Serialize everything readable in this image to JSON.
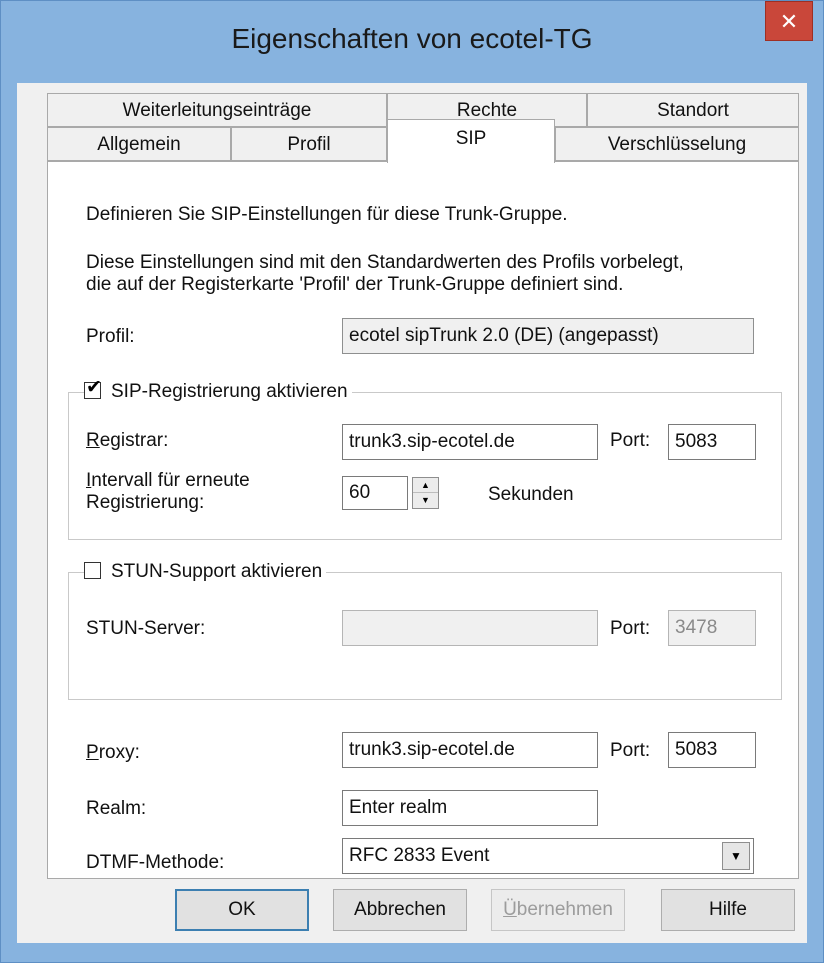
{
  "window": {
    "title": "Eigenschaften von ecotel-TG",
    "close_glyph": "✕"
  },
  "tabs": {
    "row1": [
      "Weiterleitungseinträge",
      "Rechte",
      "Standort"
    ],
    "row2": [
      "Allgemein",
      "Profil",
      "SIP",
      "Verschlüsselung"
    ],
    "active": "SIP"
  },
  "sip": {
    "intro": "Definieren Sie SIP-Einstellungen für diese Trunk-Gruppe.",
    "info_line1": "Diese Einstellungen sind mit den Standardwerten des Profils vorbelegt,",
    "info_line2": "die auf der Registerkarte  'Profil' der Trunk-Gruppe definiert sind.",
    "profil_label": "Profil:",
    "profil_value": "ecotel sipTrunk 2.0 (DE) (angepasst)",
    "registration": {
      "checkbox_label": "SIP-Registrierung aktivieren",
      "checked": true,
      "check_glyph": "✔",
      "registrar_accel": "R",
      "registrar_rest": "egistrar:",
      "registrar_value": "trunk3.sip-ecotel.de",
      "port_label": "Port:",
      "port_value": "5083",
      "interval_accel": "I",
      "interval_rest1": "ntervall für erneute",
      "interval_line2": "Registrierung:",
      "interval_value": "60",
      "interval_unit": "Sekunden",
      "spin_up": "▲",
      "spin_down": "▼"
    },
    "stun": {
      "checkbox_label": "STUN-Support aktivieren",
      "checked": false,
      "server_label": "STUN-Server:",
      "server_value": "",
      "port_label": "Port:",
      "port_value": "3478"
    },
    "proxy_accel": "P",
    "proxy_rest": "roxy:",
    "proxy_value": "trunk3.sip-ecotel.de",
    "proxy_port_label": "Port:",
    "proxy_port_value": "5083",
    "realm_label": "Realm:",
    "realm_value": "Enter realm",
    "dtmf_label": "DTMF-Methode:",
    "dtmf_value": "RFC 2833 Event",
    "dtmf_arrow": "▼"
  },
  "buttons": {
    "ok": "OK",
    "cancel": "Abbrechen",
    "apply_accel": "Ü",
    "apply_rest": "bernehmen",
    "help": "Hilfe"
  },
  "colors": {
    "title_bar": "#87b3df",
    "close": "#c9473a",
    "dialog_bg": "#f0f0f0",
    "default_button_border": "#3c7fb1"
  }
}
